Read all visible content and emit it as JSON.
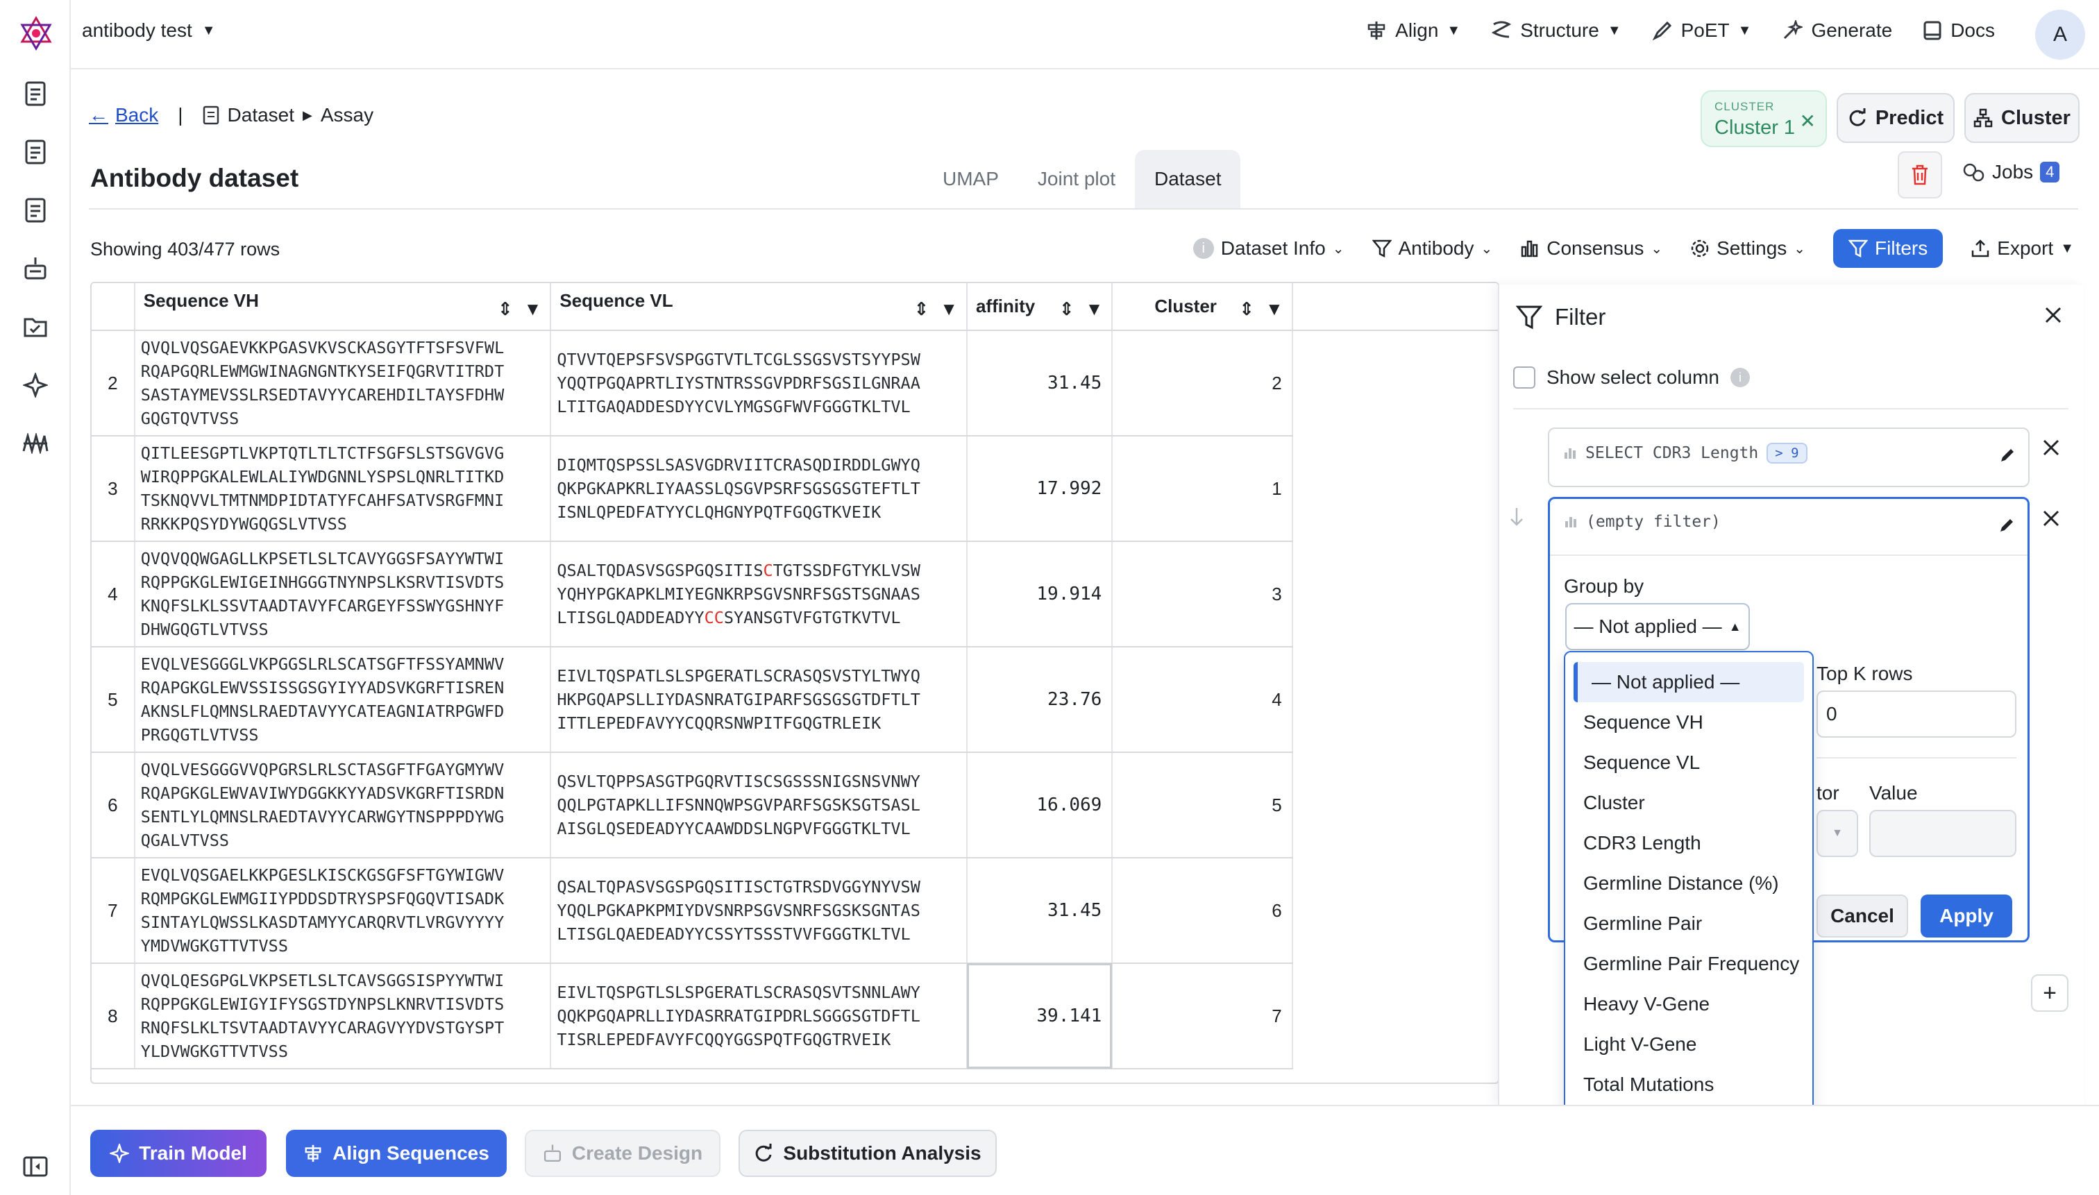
{
  "app": {
    "project_name": "antibody test",
    "avatar_initial": "A",
    "nav": [
      {
        "label": "Align",
        "icon": "align-icon",
        "dropdown": true
      },
      {
        "label": "Structure",
        "icon": "structure-icon",
        "dropdown": true
      },
      {
        "label": "PoET",
        "icon": "poet-icon",
        "dropdown": true
      },
      {
        "label": "Generate",
        "icon": "generate-icon",
        "dropdown": false
      },
      {
        "label": "Docs",
        "icon": "docs-icon",
        "dropdown": false
      }
    ]
  },
  "header": {
    "back_label": "Back",
    "breadcrumb": [
      "Dataset",
      "Assay"
    ],
    "page_title": "Antibody dataset",
    "tabs": [
      {
        "label": "UMAP",
        "active": false
      },
      {
        "label": "Joint plot",
        "active": false
      },
      {
        "label": "Dataset",
        "active": true
      }
    ],
    "cluster_chip": {
      "label": "CLUSTER",
      "value": "Cluster 1"
    },
    "predict_label": "Predict",
    "cluster_label": "Cluster",
    "jobs_label": "Jobs",
    "jobs_count": "4"
  },
  "toolbar": {
    "row_count": "Showing 403/477 rows",
    "dataset_info": "Dataset Info",
    "antibody": "Antibody",
    "consensus": "Consensus",
    "settings": "Settings",
    "filters": "Filters",
    "export": "Export"
  },
  "table": {
    "columns": [
      "Sequence VH",
      "Sequence VL",
      "affinity",
      "Cluster"
    ],
    "rows": [
      {
        "index": "2",
        "vh": [
          "QVQLVQSGAEVKKPGASVKVSCKASGYTFTSFSVFWL",
          "RQAPGQRLEWMGWINAGNGNTKYSEIFQGRVTITRDT",
          "SASTAYMEVSSLRSEDTAVYYCAREHDILTAYSFDHW",
          "GQGTQVTVSS"
        ],
        "vl": [
          "QTVVTQEPSFSVSPGGTVTLTCGLSSGSVSTSYYPSW",
          "YQQTPGQAPRTLIYSTNTRSSGVPDRFSGSILGNRAA",
          "LTITGAQADDESDYYCVLYMGSGFWVFGGGTKLTVL"
        ],
        "affinity": "31.45",
        "cluster": "2"
      },
      {
        "index": "3",
        "vh": [
          "QITLEESGPTLVKPTQTLTLTCTFSGFSLSTSGVGVG",
          "WIRQPPGKALEWLALIYWDGNNLYSPSLQNRLTITKD",
          "TSKNQVVLTMTNMDPIDTATYFCAHFSATVSRGFMNI",
          "RRKKPQSYDYWGQGSLVTVSS"
        ],
        "vl": [
          "DIQMTQSPSSLSASVGDRVIITCRASQDIRDDLGWYQ",
          "QKPGKAPKRLIYAASSLQSGVPSRFSGSGSGTEFTLT",
          "ISNLQPEDFATYYCLQHGNYPQTFGQGTKVEIK"
        ],
        "affinity": "17.992",
        "cluster": "1"
      },
      {
        "index": "4",
        "vh": [
          "QVQVQQWGAGLLKPSETLSLTCAVYGGSFSAYYWTWI",
          "RQPPGKGLEWIGEINHGGGTNYNPSLKSRVTISVDTS",
          "KNQFSLKLSSVTAADTAVYFCARGEYFSSWYGSHNYF",
          "DHWGQGTLVTVSS"
        ],
        "vl": [
          "QSALTQDASVSGSPGQSITIS|C|TGTSSDFGTYKLVSW",
          "YQHYPGKAPKLMIYEGNKRPSGVSNRFSGSTSGNAAS",
          "LTISGLQADDEADYY|CC|SYANSGTVFGTGTKVTVL"
        ],
        "affinity": "19.914",
        "cluster": "3"
      },
      {
        "index": "5",
        "vh": [
          "EVQLVESGGGLVKPGGSLRLSCATSGFTFSSYAMNWV",
          "RQAPGKGLEWVSSISSGSGYIYYADSVKGRFTISREN",
          "AKNSLFLQMNSLRAEDTAVYYCATEAGNIATRPGWFD",
          "PRGQGTLVTVSS"
        ],
        "vl": [
          "EIVLTQSPATLSLSPGERATLSCRASQSVSTYLTWYQ",
          "HKPGQAPSLLIYDASNRATGIPARFSGSGSGTDFTLT",
          "ITTLEPEDFAVYYCQQRSNWPITFGQGTRLEIK"
        ],
        "affinity": "23.76",
        "cluster": "4"
      },
      {
        "index": "6",
        "vh": [
          "QVQLVESGGGVVQPGRSLRLSCTASGFTFGAYGMYWV",
          "RQAPGKGLEWVAVIWYDGGKKYYADSVKGRFTISRDN",
          "SENTLYLQMNSLRAEDTAVYYCARWGYTNSPPPDYWG",
          "QGALVTVSS"
        ],
        "vl": [
          "QSVLTQPPSASGTPGQRVTISCSGSSSNIGSNSVNWY",
          "QQLPGTAPKLLIFSNNQWPSGVPARFSGSKSGTSASL",
          "AISGLQSEDEADYYCAAWDDSLNGPVFGGGTKLTVL"
        ],
        "affinity": "16.069",
        "cluster": "5"
      },
      {
        "index": "7",
        "vh": [
          "EVQLVQSGAELKKPGESLKISCKGSGFSFTGYWIGWV",
          "RQMPGKGLEWMGIIYPDDSDTRYSPSFQGQVTISADK",
          "SINTAYLQWSSLKASDTAMYYCARQRVTLVRGVYYYY",
          "YMDVWGKGTTVTVSS"
        ],
        "vl": [
          "QSALTQPASVSGSPGQSITISCTGTRSDVGGYNYVSW",
          "YQQLPGKAPKPMIYDVSNRPSGVSNRFSGSKSGNTAS",
          "LTISGLQAEDEADYYCSSYTSSSTVVFGGGTKLTVL"
        ],
        "affinity": "31.45",
        "cluster": "6"
      },
      {
        "index": "8",
        "vh": [
          "QVQLQESGPGLVKPSETLSLTCAVSGGSISPYYWTWI",
          "RQPPGKGLEWIGYIFYSGSTDYNPSLKNRVTISVDTS",
          "RNQFSLKLTSVTAADTAVYYCARAGVYYDVSTGYSPT",
          "YLDVWGKGTTVTVSS"
        ],
        "vl": [
          "EIVLTQSPGTLSLSPGERATLSCRASQSVTSNNLAWY",
          "QQKPGQAPRLLIYDASRRATGIPDRLSGGGSGTDFTL",
          "TISRLEPEDFAVYFCQQYGGSPQTFGQGTRVEIK"
        ],
        "affinity": "39.141",
        "cluster": "7"
      }
    ]
  },
  "filter_panel": {
    "title": "Filter",
    "show_select_label": "Show select column",
    "filters": [
      {
        "label": "SELECT CDR3 Length",
        "pill": "> 9"
      },
      {
        "label": "(empty filter)",
        "pill": ""
      }
    ],
    "group_by_label": "Group by",
    "group_by_value": "— Not applied —",
    "top_k_label": "Top K rows",
    "top_k_value": "0",
    "operator_label": "tor",
    "value_label": "Value",
    "cancel_label": "Cancel",
    "apply_label": "Apply",
    "add_label": "+"
  },
  "dropdown": {
    "options": [
      "— Not applied —",
      "Sequence VH",
      "Sequence VL",
      "Cluster",
      "CDR3 Length",
      "Germline Distance (%)",
      "Germline Pair",
      "Germline Pair Frequency",
      "Heavy V-Gene",
      "Light V-Gene",
      "Total Mutations"
    ],
    "selected_index": 0
  },
  "bottom": {
    "train_model": "Train Model",
    "align_sequences": "Align Sequences",
    "create_design": "Create Design",
    "substitution_analysis": "Substitution Analysis"
  },
  "colors": {
    "primary": "#2f6cdf",
    "mutation_red": "#e0322e",
    "cluster_green": "#2d8a5f"
  }
}
